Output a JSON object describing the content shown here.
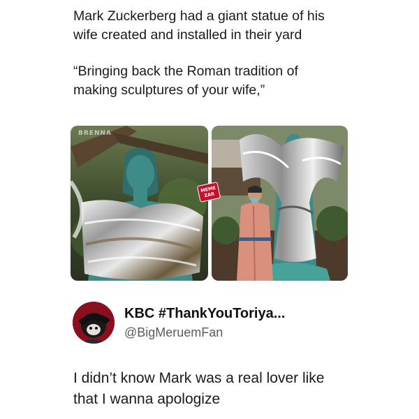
{
  "post": {
    "headline": [
      "Mark Zuckerberg had a giant statue of his",
      "wife created and installed in their yard"
    ],
    "quote": [
      "“Bringing back the Roman tradition of",
      "making sculptures of your wife,”"
    ]
  },
  "images": {
    "left_watermark": "BRENNA",
    "badge": [
      "MEME",
      "ZAR"
    ]
  },
  "reply": {
    "display_name": "KBC #ThankYouToriya...",
    "handle": "@BigMeruemFan",
    "text": [
      "I didn’t know Mark was a real lover like",
      "that I wanna apologize"
    ]
  },
  "colors": {
    "statue_teal": "#3e8c89",
    "avatar_red": "#8a1020",
    "badge_red": "#c8102e",
    "handle_gray": "#5b5b5b"
  }
}
